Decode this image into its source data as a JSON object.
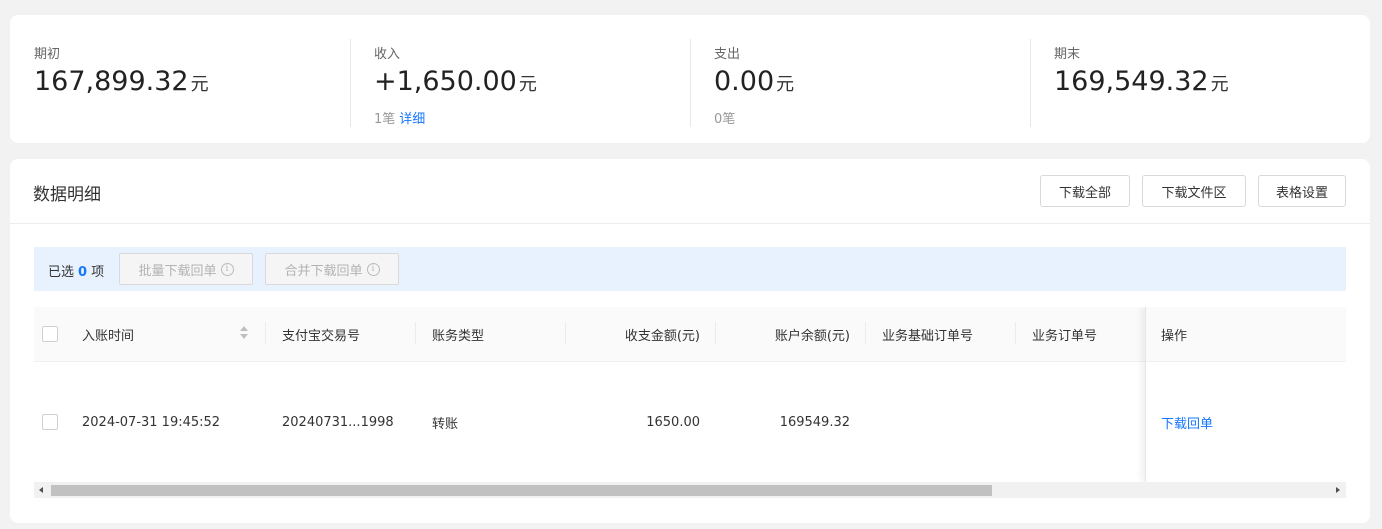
{
  "summary": {
    "opening": {
      "label": "期初",
      "amount": "167,899.32",
      "unit": "元"
    },
    "income": {
      "label": "收入",
      "amount": "+1,650.00",
      "unit": "元",
      "count": "1笔",
      "detail_link": "详细"
    },
    "expense": {
      "label": "支出",
      "amount": "0.00",
      "unit": "元",
      "count": "0笔"
    },
    "closing": {
      "label": "期末",
      "amount": "169,549.32",
      "unit": "元"
    }
  },
  "detail": {
    "title": "数据明细",
    "buttons": {
      "download_all": "下载全部",
      "download_folder": "下载文件区",
      "table_settings": "表格设置"
    }
  },
  "selection": {
    "prefix": "已选",
    "count": "0",
    "suffix": "项",
    "batch_download": "批量下载回单",
    "merge_download": "合并下载回单",
    "info_glyph": "i"
  },
  "table": {
    "columns": {
      "time": "入账时间",
      "alipay_no": "支付宝交易号",
      "type": "账务类型",
      "amount": "收支金额(元)",
      "balance": "账户余额(元)",
      "base_order": "业务基础订单号",
      "order": "业务订单号",
      "action": "操作"
    },
    "rows": [
      {
        "time": "2024-07-31 19:45:52",
        "alipay_no": "20240731...1998",
        "type": "转账",
        "amount": "1650.00",
        "balance": "169549.32",
        "base_order": "",
        "order": "",
        "action": "下载回单"
      }
    ]
  },
  "colors": {
    "accent": "#1677ff",
    "selection_bg": "#e8f2ff"
  },
  "icons": [
    "info-icon",
    "sort-icon",
    "scroll-left-arrow-icon",
    "scroll-right-arrow-icon"
  ]
}
